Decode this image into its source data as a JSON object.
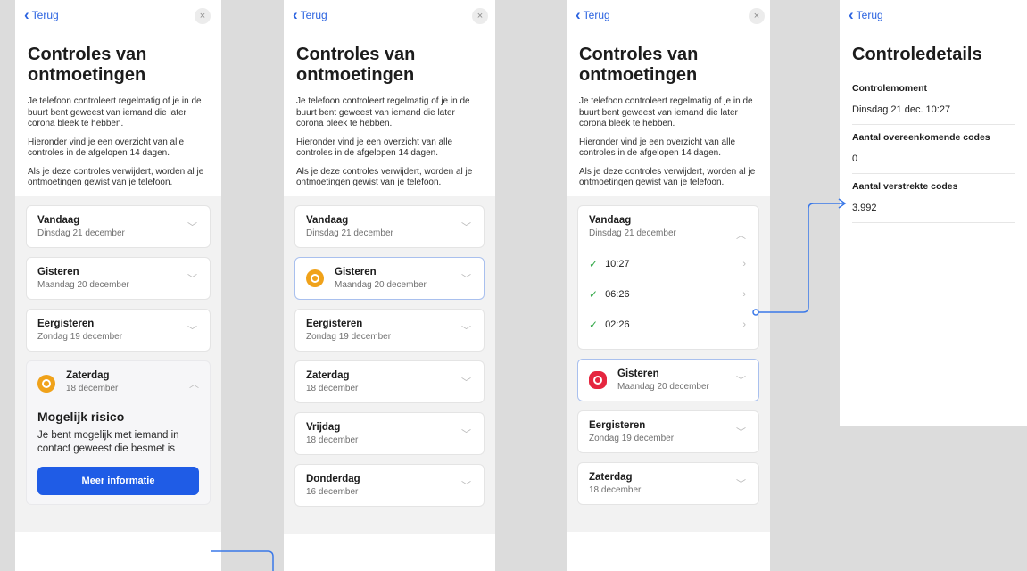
{
  "common": {
    "back_label": "Terug",
    "close_icon": "×",
    "title": "Controles van ontmoetingen",
    "intro1": "Je telefoon controleert regelmatig of je in de buurt bent geweest van iemand die later corona bleek te hebben.",
    "intro2": "Hieronder vind je een overzicht van alle controles in de afgelopen 14 dagen.",
    "intro3": "Als je deze controles verwijdert, worden al je ontmoetingen gewist van je telefoon."
  },
  "screen1": {
    "days": [
      {
        "title": "Vandaag",
        "sub": "Dinsdag 21 december"
      },
      {
        "title": "Gisteren",
        "sub": "Maandag 20 december"
      },
      {
        "title": "Eergisteren",
        "sub": "Zondag 19 december"
      }
    ],
    "expanded": {
      "title": "Zaterdag",
      "sub": "18 december",
      "risk_title": "Mogelijk risico",
      "risk_text": "Je bent mogelijk met iemand in contact geweest die besmet is",
      "button": "Meer informatie"
    }
  },
  "screen2": {
    "today": {
      "title": "Vandaag",
      "sub": "Dinsdag 21 december"
    },
    "highlight": {
      "title": "Gisteren",
      "sub": "Maandag 20 december"
    },
    "days": [
      {
        "title": "Eergisteren",
        "sub": "Zondag 19 december"
      },
      {
        "title": "Zaterdag",
        "sub": "18 december"
      },
      {
        "title": "Vrijdag",
        "sub": "18 december"
      },
      {
        "title": "Donderdag",
        "sub": "16 december"
      }
    ]
  },
  "screen3": {
    "expanded": {
      "title": "Vandaag",
      "sub": "Dinsdag 21 december",
      "times": [
        "10:27",
        "06:26",
        "02:26"
      ]
    },
    "highlight": {
      "title": "Gisteren",
      "sub": "Maandag 20 december"
    },
    "days": [
      {
        "title": "Eergisteren",
        "sub": "Zondag 19 december"
      },
      {
        "title": "Zaterdag",
        "sub": "18 december"
      }
    ]
  },
  "screen4": {
    "title": "Controledetails",
    "sections": [
      {
        "label": "Controlemoment",
        "value": "Dinsdag 21 dec. 10:27"
      },
      {
        "label": "Aantal overeenkomende codes",
        "value": "0"
      },
      {
        "label": "Aantal verstrekte codes",
        "value": "3.992"
      }
    ]
  },
  "colors": {
    "accent": "#1f5ce6",
    "link": "#2b63e0",
    "warning": "#f0a21a",
    "danger": "#e5263f",
    "connector": "#3a78e8"
  }
}
